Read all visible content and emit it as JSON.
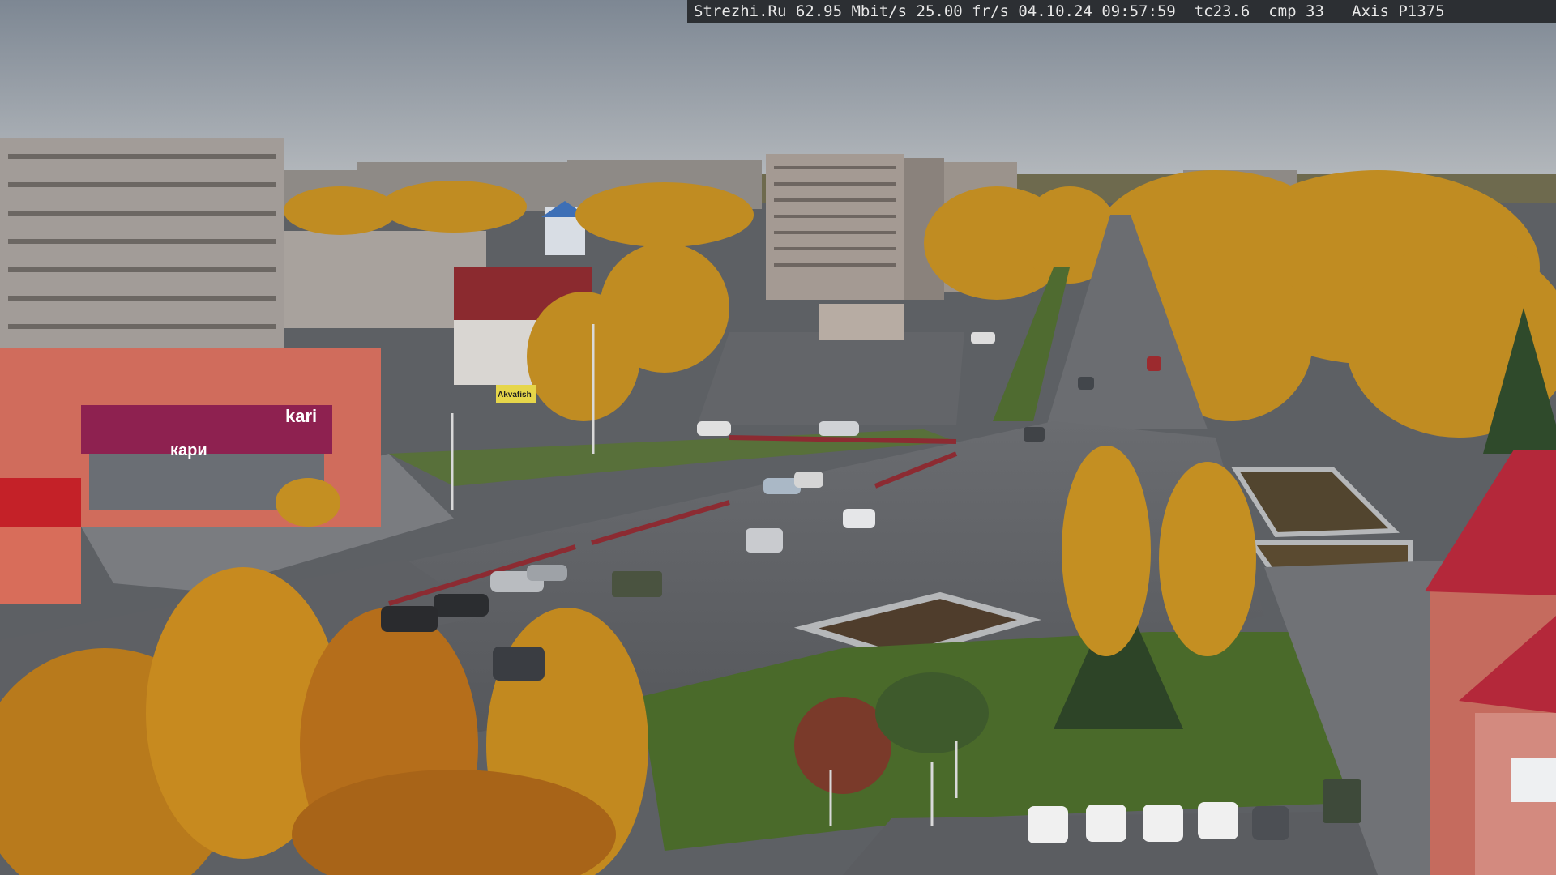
{
  "osd": {
    "text": "Strezhi.Ru 62.95 Mbit/s 25.00 fr/s 04.10.24 09:57:59  tc23.6  cmp 33   Axis P1375"
  },
  "signs": {
    "store_logo": "kari",
    "store_banner": "кари",
    "bus_stop": "Akvafish"
  },
  "colors": {
    "sky_top": "#7f8a96",
    "sky_bottom": "#b3b8bd",
    "asphalt": "#5a5c60",
    "foliage_gold": "#c8951d",
    "grass": "#4b6a2c",
    "store_red": "#c0392b"
  }
}
